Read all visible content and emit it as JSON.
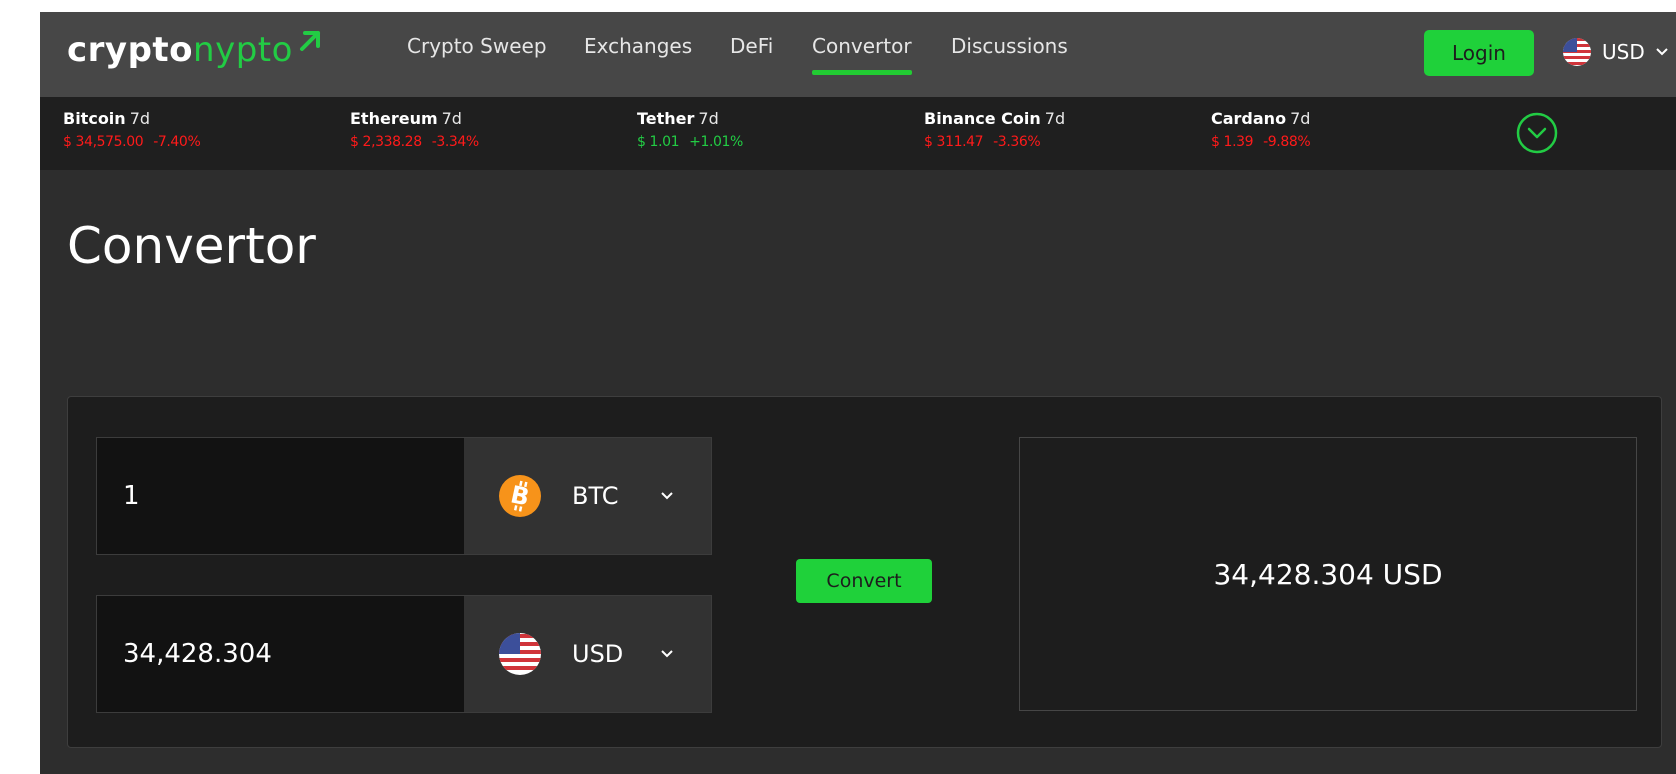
{
  "brand": {
    "part1": "crypto",
    "part2": "nypto"
  },
  "nav": [
    {
      "label": "Crypto Sweep",
      "active": false
    },
    {
      "label": "Exchanges",
      "active": false
    },
    {
      "label": "DeFi",
      "active": false
    },
    {
      "label": "Convertor",
      "active": true
    },
    {
      "label": "Discussions",
      "active": false
    }
  ],
  "header": {
    "login_label": "Login",
    "currency_label": "USD"
  },
  "ticker": [
    {
      "name": "Bitcoin",
      "period": "7d",
      "price": "$ 34,575.00",
      "change": "-7.40%",
      "trend": "down"
    },
    {
      "name": "Ethereum",
      "period": "7d",
      "price": "$ 2,338.28",
      "change": "-3.34%",
      "trend": "down"
    },
    {
      "name": "Tether",
      "period": "7d",
      "price": "$ 1.01",
      "change": "+1.01%",
      "trend": "up"
    },
    {
      "name": "Binance Coin",
      "period": "7d",
      "price": "$ 311.47",
      "change": "-3.36%",
      "trend": "down"
    },
    {
      "name": "Cardano",
      "period": "7d",
      "price": "$ 1.39",
      "change": "-9.88%",
      "trend": "down"
    }
  ],
  "page": {
    "title": "Convertor"
  },
  "converter": {
    "from": {
      "amount": "1",
      "currency": "BTC"
    },
    "to": {
      "amount": "34,428.304",
      "currency": "USD"
    },
    "convert_label": "Convert",
    "result": "34,428.304 USD"
  },
  "icons": {
    "logo_arrow": "arrow-up-right-icon",
    "flag": "us-flag-icon",
    "bitcoin": "bitcoin-icon",
    "caret": "chevron-down-icon",
    "expand": "chevron-down-circle-icon"
  },
  "colors": {
    "accent": "#22cc44",
    "negative": "#ff1a1a",
    "positive": "#22cc44",
    "bitcoin": "#f7931a"
  }
}
